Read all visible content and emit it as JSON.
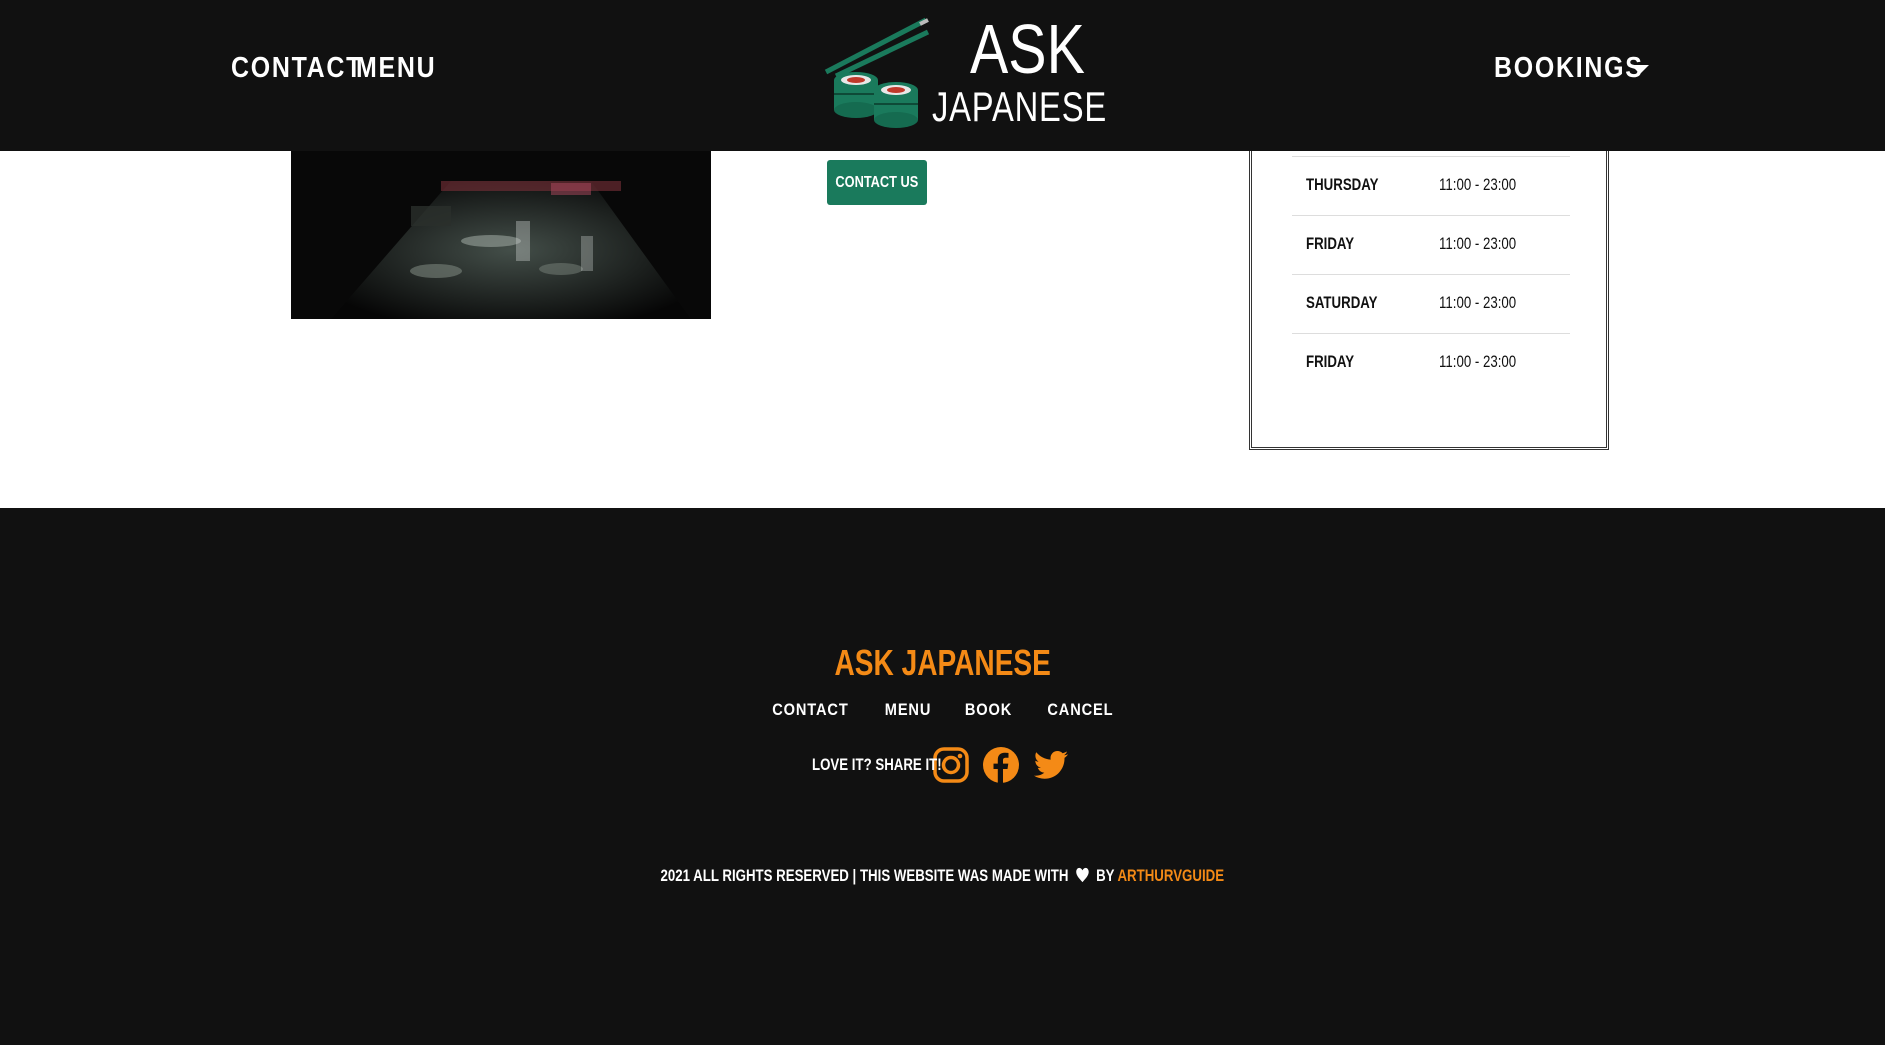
{
  "nav": {
    "contact": "CONTACT",
    "menu": "MENU",
    "bookings": "BOOKINGS",
    "logo_line1": "ASK",
    "logo_line2": "JAPANESE"
  },
  "main": {
    "contact_button": "CONTACT US",
    "hours": [
      {
        "day": "Thursday",
        "time": "11:00 - 23:00"
      },
      {
        "day": "Friday",
        "time": "11:00 - 23:00"
      },
      {
        "day": "Saturday",
        "time": "11:00 - 23:00"
      },
      {
        "day": "Friday",
        "time": "11:00 - 23:00"
      }
    ]
  },
  "footer": {
    "brand": "ASK JAPANESE",
    "links": [
      "CONTACT",
      "MENU",
      "BOOK",
      "CANCEL"
    ],
    "share_text": "LOVE IT? SHARE IT!",
    "copyright": "2021 ALL RIGHTS RESERVED | THIS WEBSITE WAS MADE WITH",
    "by": "BY",
    "author": "ARTHURVGUIDE"
  },
  "colors": {
    "background": "#111111",
    "accent": "#f48a16",
    "button_green": "#1a7a5c"
  },
  "icons": [
    "chopsticks-logo-icon",
    "instagram-icon",
    "facebook-icon",
    "twitter-icon",
    "heart-icon",
    "caret-down-icon"
  ]
}
